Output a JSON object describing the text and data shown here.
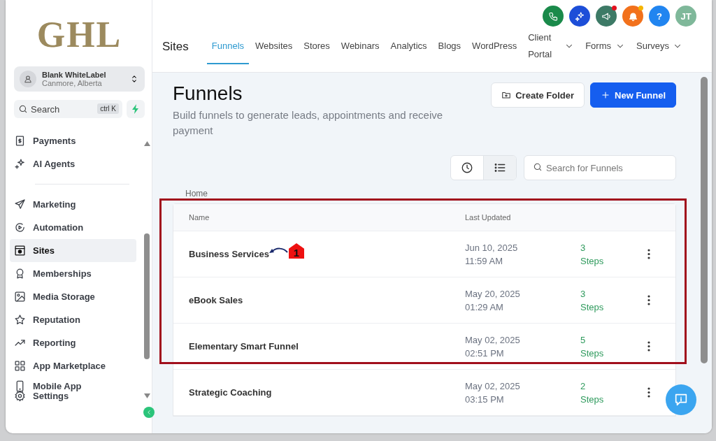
{
  "sidebar": {
    "logo": "GHL",
    "account": {
      "name": "Blank WhiteLabel",
      "location": "Canmore, Alberta"
    },
    "search": {
      "placeholder": "Search",
      "shortcut": "ctrl K"
    },
    "groups": [
      {
        "items": [
          {
            "label": "Payments",
            "selected": false
          },
          {
            "label": "AI Agents",
            "selected": false
          }
        ]
      },
      {
        "items": [
          {
            "label": "Marketing",
            "selected": false
          },
          {
            "label": "Automation",
            "selected": false
          },
          {
            "label": "Sites",
            "selected": true
          },
          {
            "label": "Memberships",
            "selected": false
          },
          {
            "label": "Media Storage",
            "selected": false
          },
          {
            "label": "Reputation",
            "selected": false
          },
          {
            "label": "Reporting",
            "selected": false
          },
          {
            "label": "App Marketplace",
            "selected": false
          },
          {
            "label": "Mobile App",
            "selected": false
          }
        ]
      }
    ],
    "footer": {
      "label": "Settings"
    }
  },
  "header": {
    "section": "Sites",
    "actions": [
      {
        "kind": "phone",
        "color": "#1a8a4a",
        "notified": false
      },
      {
        "kind": "sparkle",
        "color": "#1d4ed8",
        "notified": false
      },
      {
        "kind": "megaphone",
        "color": "#3d7a66",
        "notified": true
      },
      {
        "kind": "bell",
        "color": "#f2711c",
        "notified": true
      },
      {
        "kind": "help",
        "color": "#2185f0",
        "label": "?",
        "notified": false
      },
      {
        "kind": "avatar",
        "color": "#7fb89a",
        "label": "JT",
        "notified": false
      }
    ],
    "tabs": [
      {
        "label": "Funnels",
        "selected": true,
        "has_menu": false
      },
      {
        "label": "Websites",
        "selected": false,
        "has_menu": false
      },
      {
        "label": "Stores",
        "selected": false,
        "has_menu": false
      },
      {
        "label": "Webinars",
        "selected": false,
        "has_menu": false
      },
      {
        "label": "Analytics",
        "selected": false,
        "has_menu": false
      },
      {
        "label": "Blogs",
        "selected": false,
        "has_menu": false
      },
      {
        "label": "WordPress",
        "selected": false,
        "has_menu": false
      },
      {
        "label": "Client Portal",
        "selected": false,
        "has_menu": true
      },
      {
        "label": "Forms",
        "selected": false,
        "has_menu": true
      },
      {
        "label": "Surveys",
        "selected": false,
        "has_menu": true
      }
    ]
  },
  "page": {
    "title": "Funnels",
    "subtitle": "Build funnels to generate leads, appointments and receive payment",
    "buttons": [
      {
        "label": "Create Folder",
        "kind": "secondary"
      },
      {
        "label": "New Funnel",
        "kind": "primary"
      }
    ],
    "view_toggle": [
      {
        "kind": "clock",
        "selected": false
      },
      {
        "kind": "list",
        "selected": true
      }
    ],
    "search": {
      "placeholder": "Search for Funnels"
    },
    "breadcrumb": "Home",
    "table": {
      "columns": [
        "Name",
        "Last Updated"
      ],
      "rows": [
        {
          "name": "Business Services",
          "date": "Jun 10, 2025",
          "time": "11:59 AM",
          "steps": "3 Steps"
        },
        {
          "name": "eBook Sales",
          "date": "May 20, 2025",
          "time": "01:29 AM",
          "steps": "3 Steps"
        },
        {
          "name": "Elementary Smart Funnel",
          "date": "May 02, 2025",
          "time": "02:51 PM",
          "steps": "5 Steps"
        },
        {
          "name": "Strategic Coaching",
          "date": "May 02, 2025",
          "time": "03:15 PM",
          "steps": "2 Steps"
        }
      ]
    },
    "annotation": {
      "number": "1"
    }
  }
}
